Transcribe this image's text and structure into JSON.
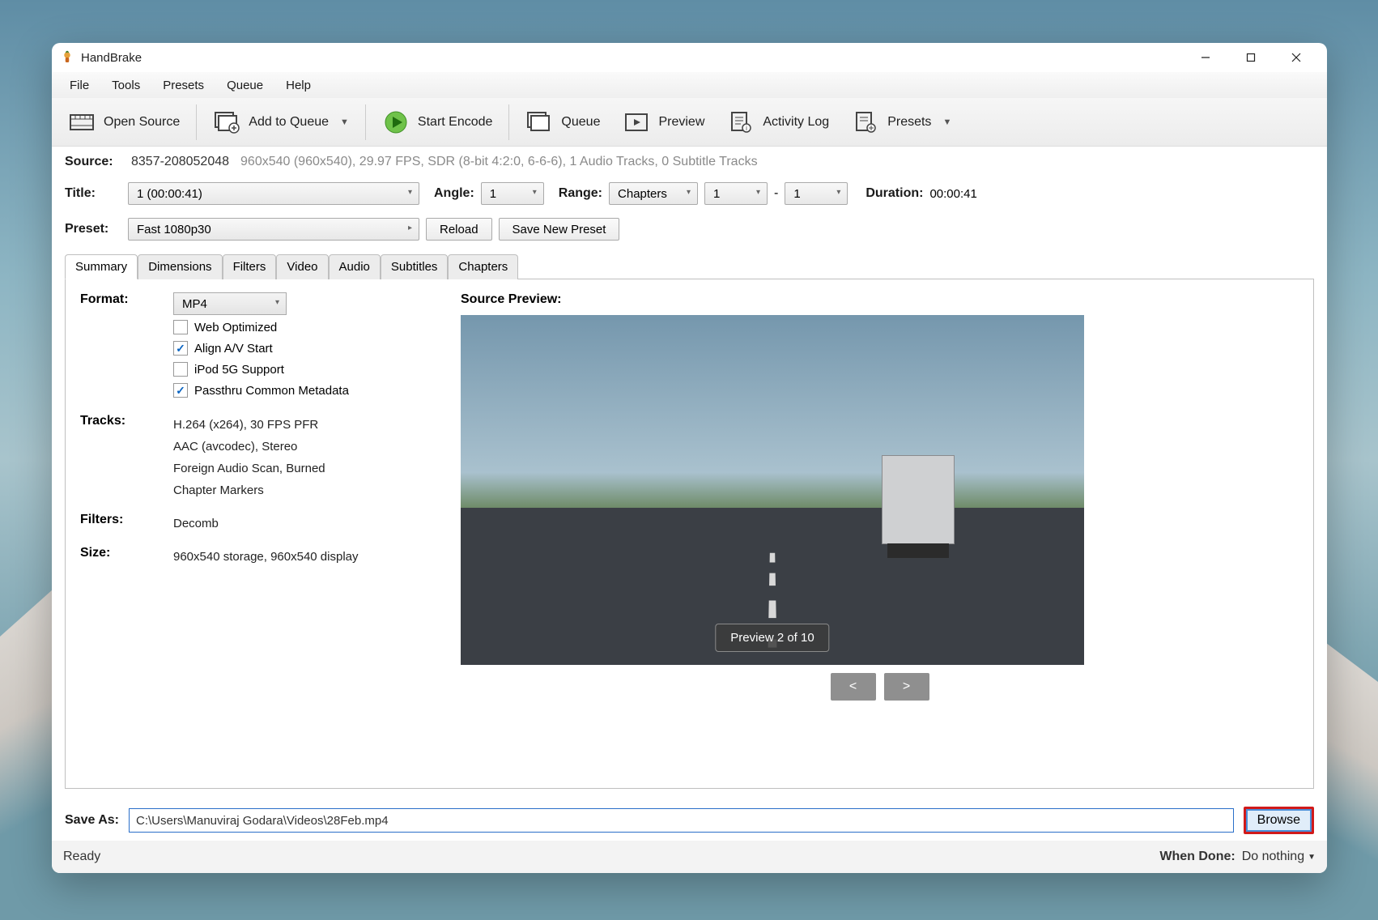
{
  "app": {
    "title": "HandBrake"
  },
  "menu": {
    "items": [
      "File",
      "Tools",
      "Presets",
      "Queue",
      "Help"
    ]
  },
  "toolbar": {
    "open_source": "Open Source",
    "add_to_queue": "Add to Queue",
    "start_encode": "Start Encode",
    "queue": "Queue",
    "preview": "Preview",
    "activity_log": "Activity Log",
    "presets": "Presets"
  },
  "source": {
    "label": "Source:",
    "id": "8357-208052048",
    "meta": "960x540 (960x540), 29.97 FPS, SDR (8-bit 4:2:0, 6-6-6), 1 Audio Tracks, 0 Subtitle Tracks"
  },
  "title_row": {
    "title_label": "Title:",
    "title_value": "1  (00:00:41)",
    "angle_label": "Angle:",
    "angle_value": "1",
    "range_label": "Range:",
    "range_mode": "Chapters",
    "range_from": "1",
    "range_sep": "-",
    "range_to": "1",
    "duration_label": "Duration:",
    "duration_value": "00:00:41"
  },
  "preset_row": {
    "preset_label": "Preset:",
    "preset_value": "Fast 1080p30",
    "reload": "Reload",
    "save_new": "Save New Preset"
  },
  "tabs": [
    "Summary",
    "Dimensions",
    "Filters",
    "Video",
    "Audio",
    "Subtitles",
    "Chapters"
  ],
  "summary": {
    "format_label": "Format:",
    "format_value": "MP4",
    "checks": {
      "web_optimized": {
        "label": "Web Optimized",
        "checked": false
      },
      "align_av": {
        "label": "Align A/V Start",
        "checked": true
      },
      "ipod": {
        "label": "iPod 5G Support",
        "checked": false
      },
      "passthru": {
        "label": "Passthru Common Metadata",
        "checked": true
      }
    },
    "tracks_label": "Tracks:",
    "tracks": [
      "H.264 (x264), 30 FPS PFR",
      "AAC (avcodec), Stereo",
      "Foreign Audio Scan, Burned",
      "Chapter Markers"
    ],
    "filters_label": "Filters:",
    "filters_value": "Decomb",
    "size_label": "Size:",
    "size_value": "960x540 storage, 960x540 display",
    "preview_label": "Source Preview:",
    "preview_badge": "Preview 2 of 10",
    "nav_prev": "<",
    "nav_next": ">"
  },
  "save": {
    "label": "Save As:",
    "path": "C:\\Users\\Manuviraj Godara\\Videos\\28Feb.mp4",
    "browse": "Browse"
  },
  "status": {
    "ready": "Ready",
    "when_done_label": "When Done:",
    "when_done_value": "Do nothing"
  }
}
